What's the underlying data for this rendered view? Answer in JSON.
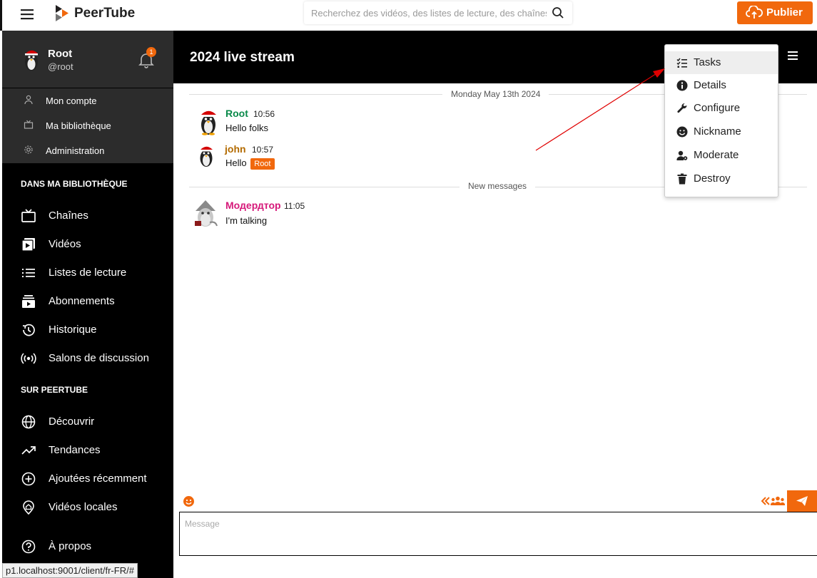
{
  "header": {
    "brand": "PeerTube",
    "search_placeholder": "Recherchez des vidéos, des listes de lecture, des chaînes",
    "publish_label": "Publier"
  },
  "user": {
    "name": "Root",
    "handle": "@root",
    "notification_count": "1"
  },
  "account_menu": [
    {
      "label": "Mon compte",
      "icon": "user-icon"
    },
    {
      "label": "Ma bibliothèque",
      "icon": "tv-icon"
    },
    {
      "label": "Administration",
      "icon": "cog-icon"
    }
  ],
  "library": {
    "title": "DANS MA BIBLIOTHÈQUE",
    "items": [
      {
        "label": "Chaînes",
        "icon": "channels-icon"
      },
      {
        "label": "Vidéos",
        "icon": "videos-icon"
      },
      {
        "label": "Listes de lecture",
        "icon": "playlists-icon"
      },
      {
        "label": "Abonnements",
        "icon": "subscriptions-icon"
      },
      {
        "label": "Historique",
        "icon": "history-icon"
      },
      {
        "label": "Salons de discussion",
        "icon": "broadcast-icon"
      }
    ]
  },
  "peertube": {
    "title": "SUR PEERTUBE",
    "items": [
      {
        "label": "Découvrir",
        "icon": "globe-icon"
      },
      {
        "label": "Tendances",
        "icon": "trending-icon"
      },
      {
        "label": "Ajoutées récemment",
        "icon": "plus-circle-icon"
      },
      {
        "label": "Vidéos locales",
        "icon": "location-icon"
      }
    ]
  },
  "about": {
    "label": "À propos",
    "icon": "help-icon"
  },
  "status_url": "p1.localhost:9001/client/fr-FR/#",
  "chat": {
    "title": "2024 live stream",
    "date_divider": "Monday May 13th 2024",
    "new_messages_divider": "New messages",
    "messages": [
      {
        "nick": "Root",
        "time": "10:56",
        "body": "Hello folks",
        "color": "#0a8a4a"
      },
      {
        "nick": "john",
        "time": "10:57",
        "body": "Hello",
        "badge": "Root",
        "color": "#b36b00"
      },
      {
        "nick": "Модердтор",
        "time": "11:05",
        "body": "I'm talking",
        "color": "#d6197a"
      }
    ],
    "menu": [
      {
        "label": "Tasks",
        "icon": "tasks-icon"
      },
      {
        "label": "Details",
        "icon": "info-icon"
      },
      {
        "label": "Configure",
        "icon": "wrench-icon"
      },
      {
        "label": "Nickname",
        "icon": "smile-icon"
      },
      {
        "label": "Moderate",
        "icon": "user-cog-icon"
      },
      {
        "label": "Destroy",
        "icon": "trash-icon"
      }
    ],
    "composer_placeholder": "Message"
  },
  "colors": {
    "accent": "#f1680d",
    "annotation_arrow": "#e00000"
  }
}
